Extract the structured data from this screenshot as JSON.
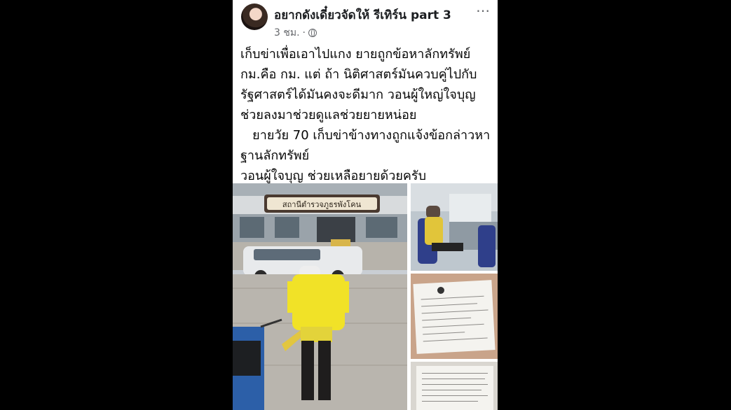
{
  "post": {
    "author": "อยากดังเดี๋ยวจัดให้ รีเทิร์น part 3",
    "time": "3 ชม.",
    "separator": "·",
    "more_icon": "⋯",
    "lines": [
      "เก็บข่าเพื่อเอาไปแกง ยายถูกข้อหาลักทรัพย์",
      "กม.คือ กม. แต่ ถ้า นิติศาสตร์มันควบคู่ไปกับ",
      "รัฐศาสตร์ได้มันคงจะดีมาก วอนผู้ใหญ่ใจบุญ",
      "ช่วยลงมาช่วยดูแลช่วยยายหน่อย",
      "   ยายวัย 70 เก็บข่าข้างทางถูกแจ้งข้อกล่าวหา",
      "ฐานลักทรัพย์",
      "วอนผู้ใจบุญ ช่วยเหลือยายด้วยครับ"
    ],
    "photo_sign": "สถานีตำรวจภูธรพังโคน"
  },
  "icons": {
    "avatar": "profile-photo",
    "globe": "globe-icon",
    "more": "more-options-icon"
  }
}
